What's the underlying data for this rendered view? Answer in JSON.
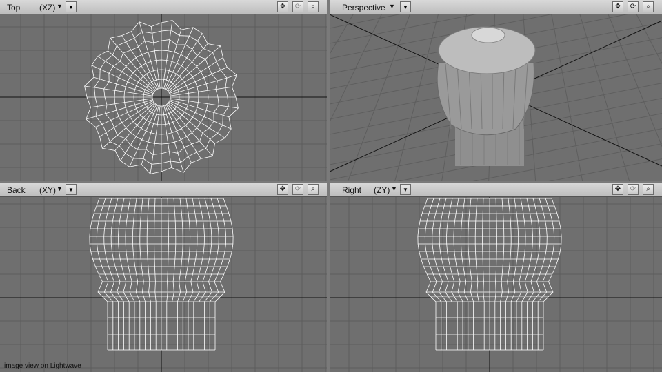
{
  "viewports": {
    "top": {
      "name": "Top",
      "axis": "(XZ)"
    },
    "persp": {
      "name": "Perspective"
    },
    "back": {
      "name": "Back",
      "axis": "(XY)"
    },
    "right": {
      "name": "Right",
      "axis": "(ZY)"
    }
  },
  "icons": {
    "move": "move-icon",
    "rotate": "rotate-icon",
    "zoom": "zoom-icon",
    "dropdown": "dropdown-arrow-icon"
  },
  "caption": "image view on Lightwave",
  "colors": {
    "grid": "#5c5c5c",
    "bg": "#6f6f6f",
    "wire": "#ffffff",
    "axis": "#111111",
    "header": "#cccccc"
  }
}
